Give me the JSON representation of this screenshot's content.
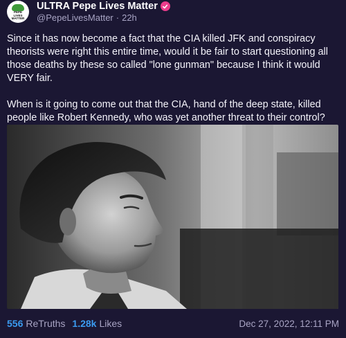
{
  "author": {
    "display_name": "ULTRA Pepe Lives Matter",
    "handle": "@PepeLivesMatter",
    "separator": "·",
    "time_ago": "22h",
    "avatar_text": [
      "PEPE",
      "LIVES",
      "MATTER"
    ],
    "verified_color": "#ec3c8c"
  },
  "post": {
    "paragraphs": [
      "Since it has now become a fact that the CIA killed JFK and conspiracy theorists were right this entire time, would it be fair to start questioning all those deaths by these so called \"lone gunman\" because I think it would VERY fair.",
      "When is it going to come out that the CIA, hand of the deep state, killed people like Robert Kennedy, who was yet another threat to their control?"
    ],
    "media": {
      "kind": "black-and-white photograph of a man in profile"
    }
  },
  "stats": {
    "retruths_count": "556",
    "retruths_label": "ReTruths",
    "likes_count": "1.28k",
    "likes_label": "Likes"
  },
  "timestamp": "Dec 27, 2022, 12:11 PM",
  "colors": {
    "background": "#1b1733",
    "accent": "#3b9bf0",
    "muted": "#a8a4c4"
  }
}
